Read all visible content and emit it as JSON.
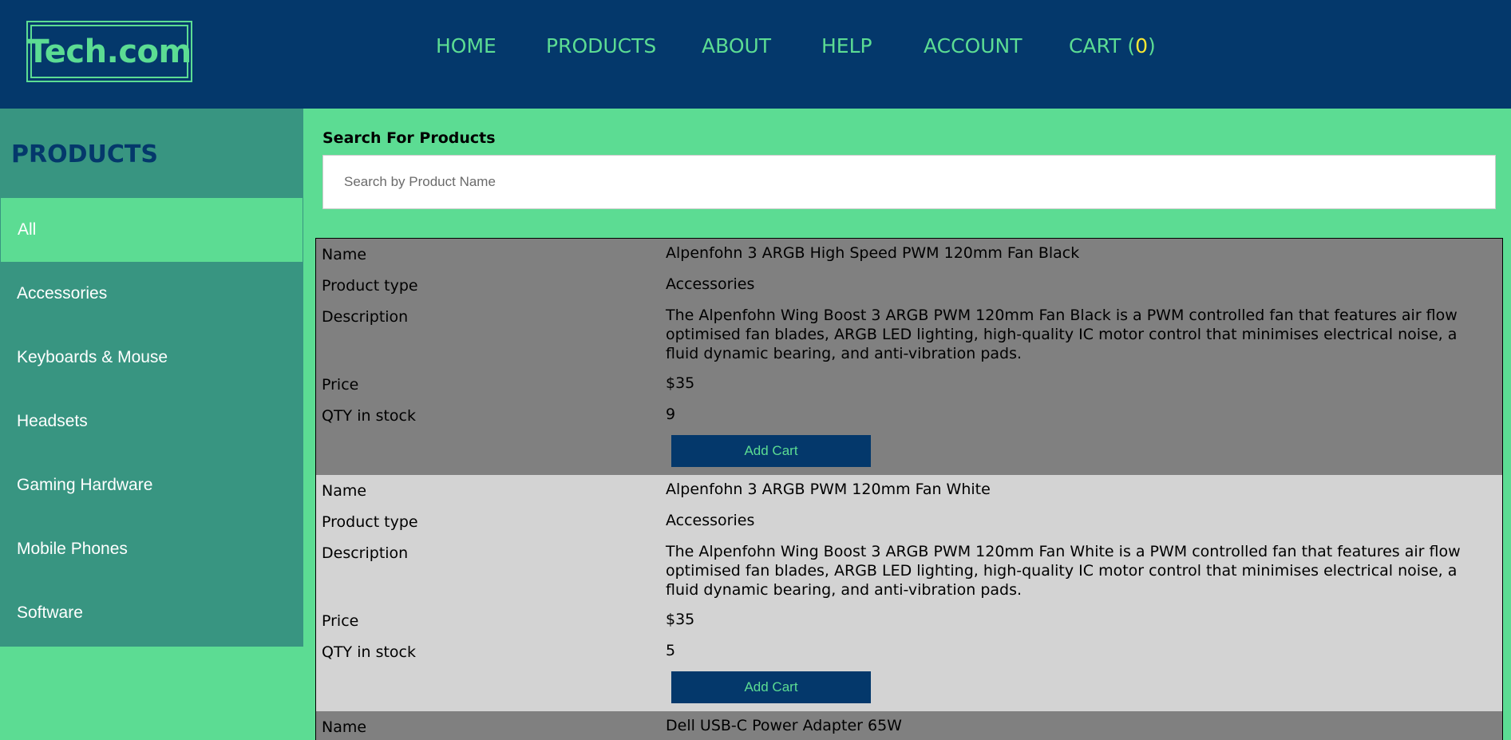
{
  "header": {
    "logo": "Tech.com",
    "nav": [
      {
        "label": "HOME"
      },
      {
        "label": "PRODUCTS"
      },
      {
        "label": "ABOUT"
      },
      {
        "label": "HELP"
      },
      {
        "label": "ACCOUNT"
      }
    ],
    "cart_label": "CART (",
    "cart_count": "0",
    "cart_close": ")"
  },
  "sidebar": {
    "title": "PRODUCTS",
    "items": [
      {
        "label": "All",
        "active": true
      },
      {
        "label": "Accessories"
      },
      {
        "label": "Keyboards & Mouse"
      },
      {
        "label": "Headsets"
      },
      {
        "label": "Gaming Hardware"
      },
      {
        "label": "Mobile Phones"
      },
      {
        "label": "Software"
      }
    ]
  },
  "search": {
    "label": "Search For Products",
    "placeholder": "Search by Product Name",
    "value": ""
  },
  "fields": {
    "name": "Name",
    "type": "Product type",
    "description": "Description",
    "price": "Price",
    "qty": "QTY in stock"
  },
  "products": [
    {
      "name": "Alpenfohn 3 ARGB High Speed PWM 120mm Fan Black",
      "type": "Accessories",
      "description": "The Alpenfohn Wing Boost 3 ARGB PWM 120mm Fan Black is a PWM controlled fan that features air flow optimised fan blades, ARGB LED lighting, high-quality IC motor control that minimises electrical noise, a fluid dynamic bearing, and anti-vibration pads.",
      "price": "$35",
      "qty": "9",
      "button": "Add Cart"
    },
    {
      "name": "Alpenfohn 3 ARGB PWM 120mm Fan White",
      "type": "Accessories",
      "description": "The Alpenfohn Wing Boost 3 ARGB PWM 120mm Fan White is a PWM controlled fan that features air flow optimised fan blades, ARGB LED lighting, high-quality IC motor control that minimises electrical noise, a fluid dynamic bearing, and anti-vibration pads.",
      "price": "$35",
      "qty": "5",
      "button": "Add Cart"
    },
    {
      "name": "Dell USB-C Power Adapter 65W"
    }
  ],
  "colors": {
    "header_bg": "#04386b",
    "accent_green": "#5cdc93",
    "sidebar_bg": "#389581",
    "cart_count": "#f7e733",
    "row_dark": "#808080",
    "row_light": "#d3d3d3"
  }
}
